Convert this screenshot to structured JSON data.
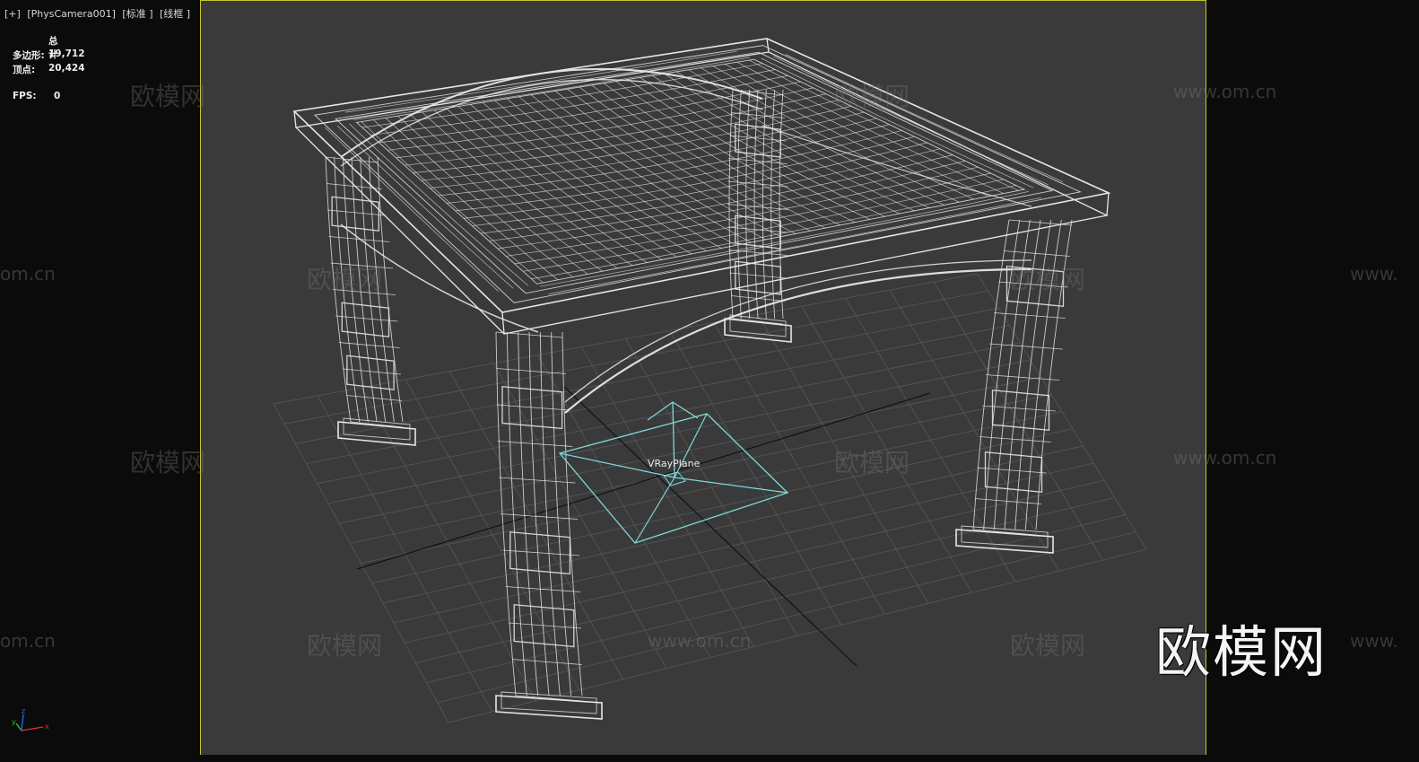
{
  "viewport": {
    "label_parts": [
      "[+]",
      "[PhysCamera001]",
      "[标准 ]",
      "[线框 ]"
    ],
    "stats": {
      "header": "总计",
      "polygons_label": "多边形:",
      "polygons_value": "19,712",
      "vertices_label": "顶点:",
      "vertices_value": "20,424"
    },
    "fps_label": "FPS:",
    "fps_value": "0",
    "object_label": "VRayPlane",
    "frame_color": "#c9c42a",
    "wire_color": "#e6e6e6",
    "plane_color": "#7fd8d8"
  },
  "watermarks": {
    "brand": "欧模网",
    "url": "www.om.cn",
    "url_fragment_left": "om.cn",
    "url_fragment_right": "www."
  },
  "axis_gizmo": {
    "x": "x",
    "y": "y",
    "z": "z"
  }
}
